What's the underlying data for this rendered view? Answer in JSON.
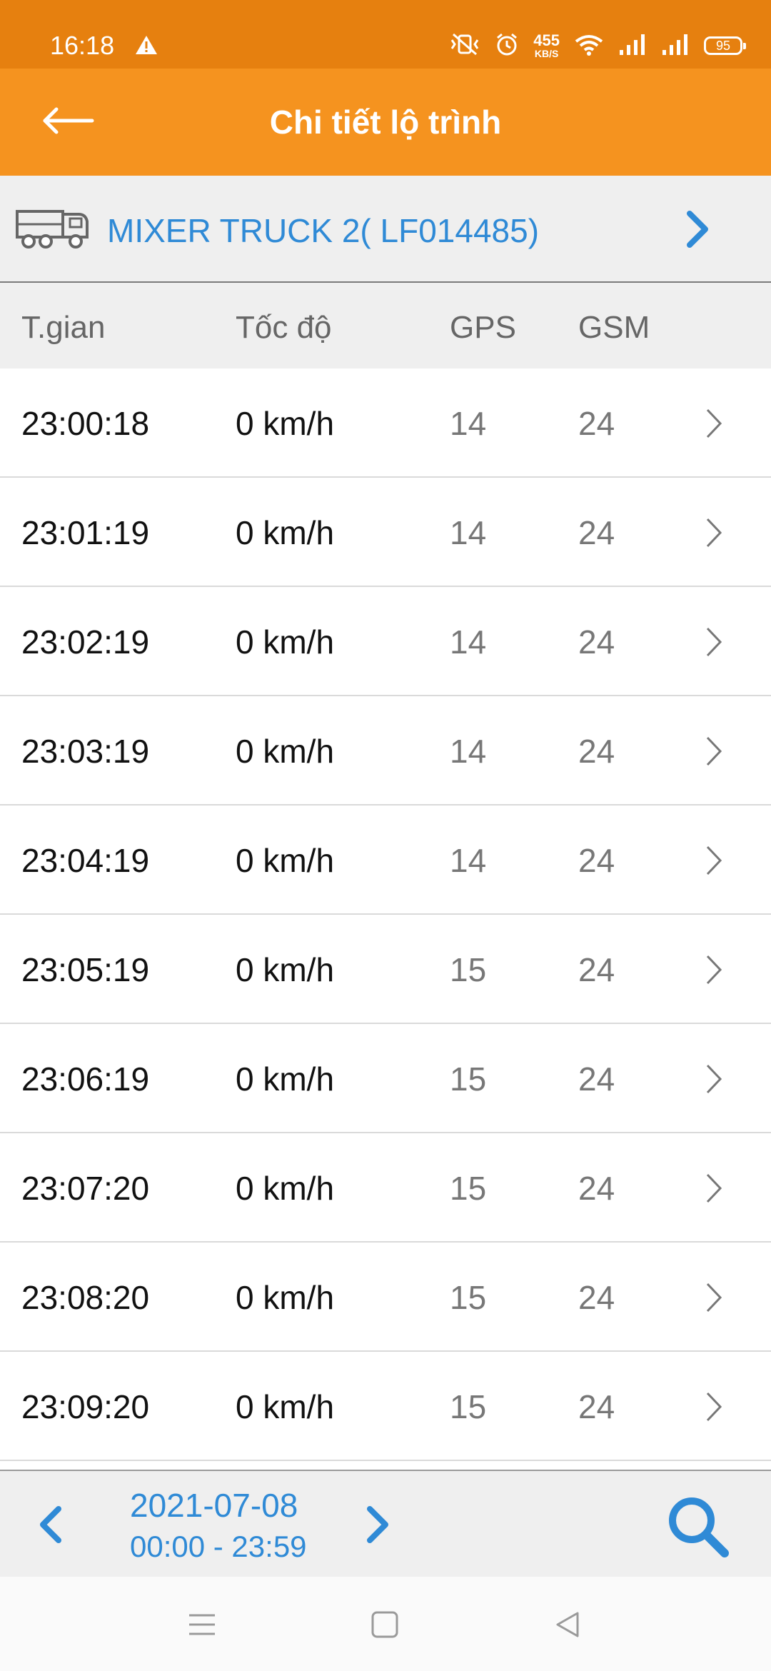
{
  "status_bar": {
    "time": "16:18",
    "net_speed_value": "455",
    "net_speed_unit": "KB/S",
    "battery": "95"
  },
  "app_bar": {
    "title": "Chi tiết lộ trình"
  },
  "vehicle": {
    "name": "MIXER TRUCK 2( LF014485)"
  },
  "table": {
    "headers": {
      "time": "T.gian",
      "speed": "Tốc độ",
      "gps": "GPS",
      "gsm": "GSM"
    },
    "rows": [
      {
        "time": "23:00:18",
        "speed": "0 km/h",
        "gps": "14",
        "gsm": "24"
      },
      {
        "time": "23:01:19",
        "speed": "0 km/h",
        "gps": "14",
        "gsm": "24"
      },
      {
        "time": "23:02:19",
        "speed": "0 km/h",
        "gps": "14",
        "gsm": "24"
      },
      {
        "time": "23:03:19",
        "speed": "0 km/h",
        "gps": "14",
        "gsm": "24"
      },
      {
        "time": "23:04:19",
        "speed": "0 km/h",
        "gps": "14",
        "gsm": "24"
      },
      {
        "time": "23:05:19",
        "speed": "0 km/h",
        "gps": "15",
        "gsm": "24"
      },
      {
        "time": "23:06:19",
        "speed": "0 km/h",
        "gps": "15",
        "gsm": "24"
      },
      {
        "time": "23:07:20",
        "speed": "0 km/h",
        "gps": "15",
        "gsm": "24"
      },
      {
        "time": "23:08:20",
        "speed": "0 km/h",
        "gps": "15",
        "gsm": "24"
      },
      {
        "time": "23:09:20",
        "speed": "0 km/h",
        "gps": "15",
        "gsm": "24"
      }
    ]
  },
  "footer": {
    "date": "2021-07-08",
    "time_range": "00:00 - 23:59"
  },
  "colors": {
    "status_bar": "#E6800F",
    "app_bar": "#F5931F",
    "accent": "#2F8AD6"
  },
  "icons": {
    "back": "arrow-left-icon",
    "vehicle": "truck-icon",
    "row_chevron": "chevron-right-icon",
    "search": "search-icon"
  }
}
